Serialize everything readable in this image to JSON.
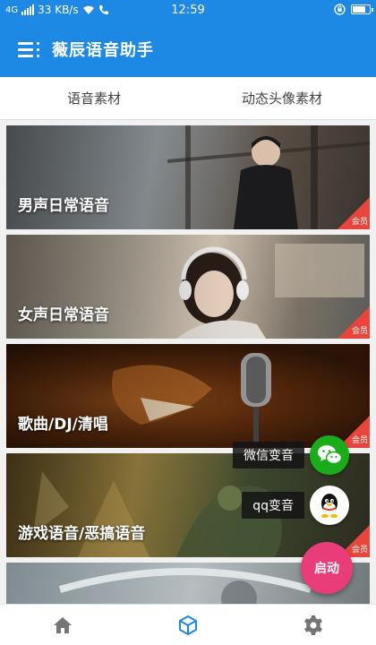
{
  "status_bar": {
    "network": "4G",
    "speed": "33 KB/s",
    "time": "12:59",
    "battery_level": 0.85
  },
  "app_bar": {
    "title": "薇辰语音助手"
  },
  "tabs": [
    {
      "label": "语音素材"
    },
    {
      "label": "动态头像素材"
    }
  ],
  "categories": [
    {
      "label": "男声日常语音",
      "badge": "会员"
    },
    {
      "label": "女声日常语音",
      "badge": "会员"
    },
    {
      "label": "歌曲/DJ/清唱",
      "badge": "会员"
    },
    {
      "label": "游戏语音/恶搞语音",
      "badge": "会员"
    },
    {
      "label": "",
      "badge": ""
    }
  ],
  "floating_actions": {
    "wechat_label": "微信变音",
    "qq_label": "qq变音",
    "start_label": "启动"
  },
  "bottom_nav": [
    {
      "icon": "home-icon"
    },
    {
      "icon": "cube-icon"
    },
    {
      "icon": "gear-icon"
    }
  ],
  "colors": {
    "primary": "#1e88e5",
    "vip_badge": "#e8453c",
    "start_button": "#e93d7a",
    "wechat": "#1aad19",
    "active_nav": "#1e88e5"
  }
}
